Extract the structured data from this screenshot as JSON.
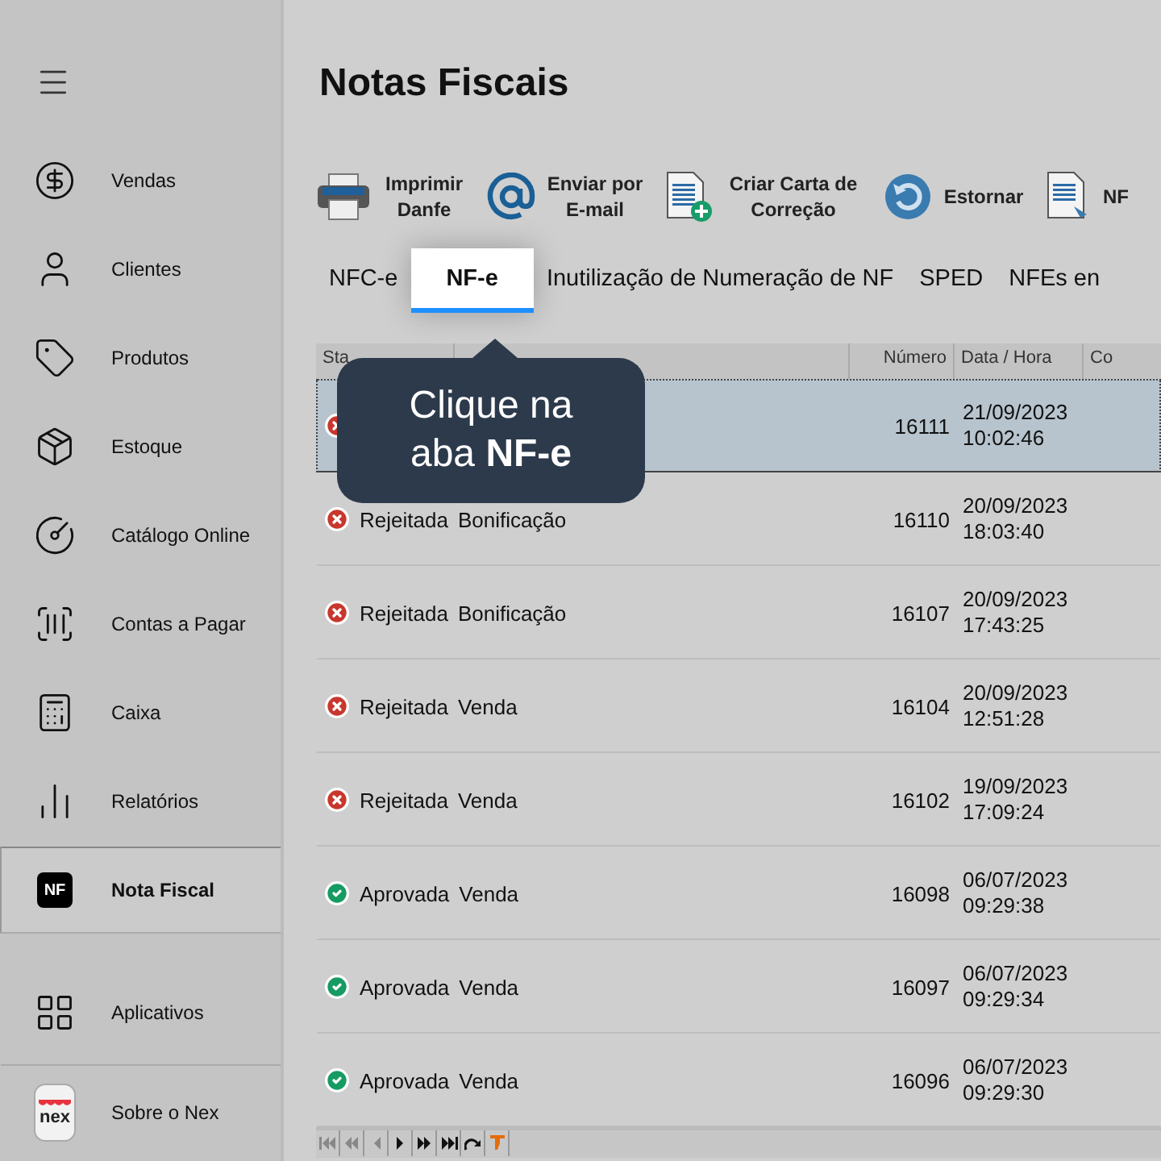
{
  "sidebar": {
    "items": [
      {
        "label": "Vendas",
        "selected": false
      },
      {
        "label": "Clientes",
        "selected": false
      },
      {
        "label": "Produtos",
        "selected": false
      },
      {
        "label": "Estoque",
        "selected": false
      },
      {
        "label": "Catálogo Online",
        "selected": false
      },
      {
        "label": "Contas a Pagar",
        "selected": false
      },
      {
        "label": "Caixa",
        "selected": false
      },
      {
        "label": "Relatórios",
        "selected": false
      },
      {
        "label": "Nota Fiscal",
        "selected": true,
        "badge": "NF"
      }
    ],
    "bottom_items": [
      {
        "label": "Aplicativos"
      },
      {
        "label": "Sobre o Nex",
        "logo": "nex"
      }
    ]
  },
  "page": {
    "title": "Notas Fiscais"
  },
  "toolbar": [
    "Imprimir Danfe",
    "Enviar por E-mail",
    "Criar Carta de Correção",
    "Estornar",
    "NF"
  ],
  "tabs": [
    {
      "label": "NFC-e",
      "selected": false
    },
    {
      "label": "NF-e",
      "selected": true
    },
    {
      "label": "Inutilização de Numeração de NF",
      "selected": false
    },
    {
      "label": "SPED",
      "selected": false
    },
    {
      "label": "NFEs en",
      "selected": false
    }
  ],
  "table": {
    "columns": [
      "Sta",
      "",
      "Número",
      "Data / Hora",
      "Co"
    ],
    "rows": [
      {
        "kind": "rejected",
        "number": "16111",
        "date": "21/09/2023",
        "time": "10:02:46",
        "selected": true
      },
      {
        "kind": "rejected",
        "status_label": "Rejeitada",
        "type": "Bonificação",
        "number": "16110",
        "date": "20/09/2023",
        "time": "18:03:40",
        "selected": false
      },
      {
        "kind": "rejected",
        "status_label": "Rejeitada",
        "type": "Bonificação",
        "number": "16107",
        "date": "20/09/2023",
        "time": "17:43:25",
        "selected": false
      },
      {
        "kind": "rejected",
        "status_label": "Rejeitada",
        "type": "Venda",
        "number": "16104",
        "date": "20/09/2023",
        "time": "12:51:28",
        "selected": false
      },
      {
        "kind": "rejected",
        "status_label": "Rejeitada",
        "type": "Venda",
        "number": "16102",
        "date": "19/09/2023",
        "time": "17:09:24",
        "selected": false
      },
      {
        "kind": "approved",
        "status_label": "Aprovada",
        "type": "Venda",
        "number": "16098",
        "date": "06/07/2023",
        "time": "09:29:38",
        "selected": false
      },
      {
        "kind": "approved",
        "status_label": "Aprovada",
        "type": "Venda",
        "number": "16097",
        "date": "06/07/2023",
        "time": "09:29:34",
        "selected": false
      },
      {
        "kind": "approved",
        "status_label": "Aprovada",
        "type": "Venda",
        "number": "16096",
        "date": "06/07/2023",
        "time": "09:29:30",
        "selected": false
      }
    ]
  },
  "pager": [
    {
      "kind": "first",
      "disabled": true
    },
    {
      "kind": "prev_page",
      "disabled": true
    },
    {
      "kind": "prev",
      "disabled": true
    },
    {
      "kind": "next",
      "disabled": false
    },
    {
      "kind": "next_page",
      "disabled": false
    },
    {
      "kind": "last",
      "disabled": false
    },
    {
      "kind": "refresh",
      "disabled": false
    },
    {
      "kind": "filter",
      "disabled": false
    }
  ],
  "tooltip": {
    "text": "Clique na aba **NF-e**"
  }
}
